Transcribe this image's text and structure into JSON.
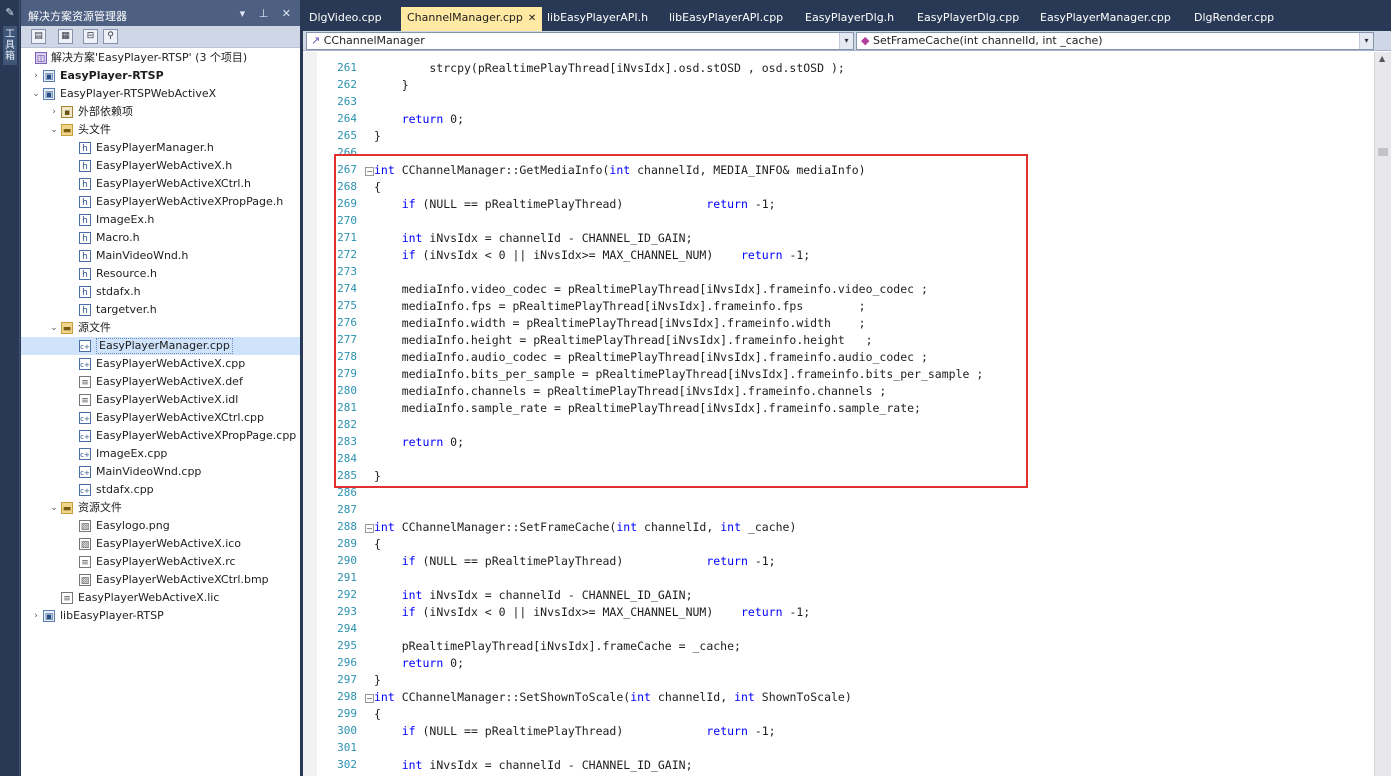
{
  "toolbox": {
    "label": "工具箱"
  },
  "solution_explorer": {
    "title": "解决方案资源管理器",
    "title_controls": "▾ ⊥ ✕",
    "tree": [
      {
        "label": "解决方案'EasyPlayer-RTSP' (3 个项目)",
        "icon": "sln",
        "level": 0,
        "arrow": "",
        "bold": false
      },
      {
        "label": "EasyPlayer-RTSP",
        "icon": "proj",
        "level": 0,
        "arrow": "›",
        "bold": true
      },
      {
        "label": "EasyPlayer-RTSPWebActiveX",
        "icon": "proj",
        "level": 0,
        "arrow": "⌄",
        "bold": false
      },
      {
        "label": "外部依赖项",
        "icon": "dep",
        "level": 1,
        "arrow": "›",
        "bold": false
      },
      {
        "label": "头文件",
        "icon": "fold",
        "level": 1,
        "arrow": "⌄",
        "bold": false
      },
      {
        "label": "EasyPlayerManager.h",
        "icon": "h",
        "level": 2,
        "arrow": "",
        "bold": false
      },
      {
        "label": "EasyPlayerWebActiveX.h",
        "icon": "h",
        "level": 2,
        "arrow": "",
        "bold": false
      },
      {
        "label": "EasyPlayerWebActiveXCtrl.h",
        "icon": "h",
        "level": 2,
        "arrow": "",
        "bold": false
      },
      {
        "label": "EasyPlayerWebActiveXPropPage.h",
        "icon": "h",
        "level": 2,
        "arrow": "",
        "bold": false
      },
      {
        "label": "ImageEx.h",
        "icon": "h",
        "level": 2,
        "arrow": "",
        "bold": false
      },
      {
        "label": "Macro.h",
        "icon": "h",
        "level": 2,
        "arrow": "",
        "bold": false
      },
      {
        "label": "MainVideoWnd.h",
        "icon": "h",
        "level": 2,
        "arrow": "",
        "bold": false
      },
      {
        "label": "Resource.h",
        "icon": "h",
        "level": 2,
        "arrow": "",
        "bold": false
      },
      {
        "label": "stdafx.h",
        "icon": "h",
        "level": 2,
        "arrow": "",
        "bold": false
      },
      {
        "label": "targetver.h",
        "icon": "h",
        "level": 2,
        "arrow": "",
        "bold": false
      },
      {
        "label": "源文件",
        "icon": "fold",
        "level": 1,
        "arrow": "⌄",
        "bold": false
      },
      {
        "label": "EasyPlayerManager.cpp",
        "icon": "cpp",
        "level": 2,
        "arrow": "",
        "bold": false,
        "selected": true
      },
      {
        "label": "EasyPlayerWebActiveX.cpp",
        "icon": "cpp",
        "level": 2,
        "arrow": "",
        "bold": false
      },
      {
        "label": "EasyPlayerWebActiveX.def",
        "icon": "doc",
        "level": 2,
        "arrow": "",
        "bold": false
      },
      {
        "label": "EasyPlayerWebActiveX.idl",
        "icon": "doc",
        "level": 2,
        "arrow": "",
        "bold": false
      },
      {
        "label": "EasyPlayerWebActiveXCtrl.cpp",
        "icon": "cpp",
        "level": 2,
        "arrow": "",
        "bold": false
      },
      {
        "label": "EasyPlayerWebActiveXPropPage.cpp",
        "icon": "cpp",
        "level": 2,
        "arrow": "",
        "bold": false
      },
      {
        "label": "ImageEx.cpp",
        "icon": "cpp",
        "level": 2,
        "arrow": "",
        "bold": false
      },
      {
        "label": "MainVideoWnd.cpp",
        "icon": "cpp",
        "level": 2,
        "arrow": "",
        "bold": false
      },
      {
        "label": "stdafx.cpp",
        "icon": "cpp",
        "level": 2,
        "arrow": "",
        "bold": false
      },
      {
        "label": "资源文件",
        "icon": "fold",
        "level": 1,
        "arrow": "⌄",
        "bold": false
      },
      {
        "label": "Easylogo.png",
        "icon": "img",
        "level": 2,
        "arrow": "",
        "bold": false
      },
      {
        "label": "EasyPlayerWebActiveX.ico",
        "icon": "img",
        "level": 2,
        "arrow": "",
        "bold": false
      },
      {
        "label": "EasyPlayerWebActiveX.rc",
        "icon": "doc",
        "level": 2,
        "arrow": "",
        "bold": false
      },
      {
        "label": "EasyPlayerWebActiveXCtrl.bmp",
        "icon": "img",
        "level": 2,
        "arrow": "",
        "bold": false
      },
      {
        "label": "EasyPlayerWebActiveX.lic",
        "icon": "doc",
        "level": 1,
        "arrow": "",
        "bold": false
      },
      {
        "label": "libEasyPlayer-RTSP",
        "icon": "proj",
        "level": 0,
        "arrow": "›",
        "bold": false
      }
    ]
  },
  "editor": {
    "tabs": [
      {
        "label": "DlgVideo.cpp",
        "active": false
      },
      {
        "label": "ChannelManager.cpp",
        "active": true
      },
      {
        "label": "libEasyPlayerAPI.h",
        "active": false
      },
      {
        "label": "libEasyPlayerAPI.cpp",
        "active": false
      },
      {
        "label": "EasyPlayerDlg.h",
        "active": false
      },
      {
        "label": "EasyPlayerDlg.cpp",
        "active": false
      },
      {
        "label": "EasyPlayerManager.cpp",
        "active": false
      },
      {
        "label": "DlgRender.cpp",
        "active": false
      }
    ],
    "nav_scope": "CChannelManager",
    "nav_member": "SetFrameCache(int channelId, int _cache)",
    "lines": [
      {
        "n": "261",
        "text": "        strcpy(pRealtimePlayThread[iNvsIdx].osd.stOSD , osd.stOSD );"
      },
      {
        "n": "262",
        "text": "    }"
      },
      {
        "n": "263",
        "text": ""
      },
      {
        "n": "264",
        "text": "    return 0;"
      },
      {
        "n": "265",
        "text": "}"
      },
      {
        "n": "266",
        "text": ""
      },
      {
        "n": "267",
        "text": "int CChannelManager::GetMediaInfo(int channelId, MEDIA_INFO& mediaInfo)",
        "fold": true
      },
      {
        "n": "268",
        "text": "{"
      },
      {
        "n": "269",
        "text": "    if (NULL == pRealtimePlayThread)            return -1;"
      },
      {
        "n": "270",
        "text": ""
      },
      {
        "n": "271",
        "text": "    int iNvsIdx = channelId - CHANNEL_ID_GAIN;"
      },
      {
        "n": "272",
        "text": "    if (iNvsIdx < 0 || iNvsIdx>= MAX_CHANNEL_NUM)    return -1;"
      },
      {
        "n": "273",
        "text": ""
      },
      {
        "n": "274",
        "text": "    mediaInfo.video_codec = pRealtimePlayThread[iNvsIdx].frameinfo.video_codec ;"
      },
      {
        "n": "275",
        "text": "    mediaInfo.fps = pRealtimePlayThread[iNvsIdx].frameinfo.fps        ;"
      },
      {
        "n": "276",
        "text": "    mediaInfo.width = pRealtimePlayThread[iNvsIdx].frameinfo.width    ;"
      },
      {
        "n": "277",
        "text": "    mediaInfo.height = pRealtimePlayThread[iNvsIdx].frameinfo.height   ;"
      },
      {
        "n": "278",
        "text": "    mediaInfo.audio_codec = pRealtimePlayThread[iNvsIdx].frameinfo.audio_codec ;"
      },
      {
        "n": "279",
        "text": "    mediaInfo.bits_per_sample = pRealtimePlayThread[iNvsIdx].frameinfo.bits_per_sample ;"
      },
      {
        "n": "280",
        "text": "    mediaInfo.channels = pRealtimePlayThread[iNvsIdx].frameinfo.channels ;"
      },
      {
        "n": "281",
        "text": "    mediaInfo.sample_rate = pRealtimePlayThread[iNvsIdx].frameinfo.sample_rate;"
      },
      {
        "n": "282",
        "text": ""
      },
      {
        "n": "283",
        "text": "    return 0;"
      },
      {
        "n": "284",
        "text": ""
      },
      {
        "n": "285",
        "text": "}"
      },
      {
        "n": "286",
        "text": ""
      },
      {
        "n": "287",
        "text": ""
      },
      {
        "n": "288",
        "text": "int CChannelManager::SetFrameCache(int channelId, int _cache)",
        "fold": true
      },
      {
        "n": "289",
        "text": "{"
      },
      {
        "n": "290",
        "text": "    if (NULL == pRealtimePlayThread)            return -1;"
      },
      {
        "n": "291",
        "text": ""
      },
      {
        "n": "292",
        "text": "    int iNvsIdx = channelId - CHANNEL_ID_GAIN;"
      },
      {
        "n": "293",
        "text": "    if (iNvsIdx < 0 || iNvsIdx>= MAX_CHANNEL_NUM)    return -1;"
      },
      {
        "n": "294",
        "text": ""
      },
      {
        "n": "295",
        "text": "    pRealtimePlayThread[iNvsIdx].frameCache = _cache;"
      },
      {
        "n": "296",
        "text": "    return 0;"
      },
      {
        "n": "297",
        "text": "}"
      },
      {
        "n": "298",
        "text": "int CChannelManager::SetShownToScale(int channelId, int ShownToScale)",
        "fold": true
      },
      {
        "n": "299",
        "text": "{"
      },
      {
        "n": "300",
        "text": "    if (NULL == pRealtimePlayThread)            return -1;"
      },
      {
        "n": "301",
        "text": ""
      },
      {
        "n": "302",
        "text": "    int iNvsIdx = channelId - CHANNEL_ID_GAIN;"
      }
    ],
    "keywords": [
      "int",
      "if",
      "return"
    ]
  },
  "colors": {
    "highlight_border": "#e03030",
    "active_tab": "#ffe9a3",
    "keyword": "#0000ff",
    "line_number": "#2b91af"
  }
}
